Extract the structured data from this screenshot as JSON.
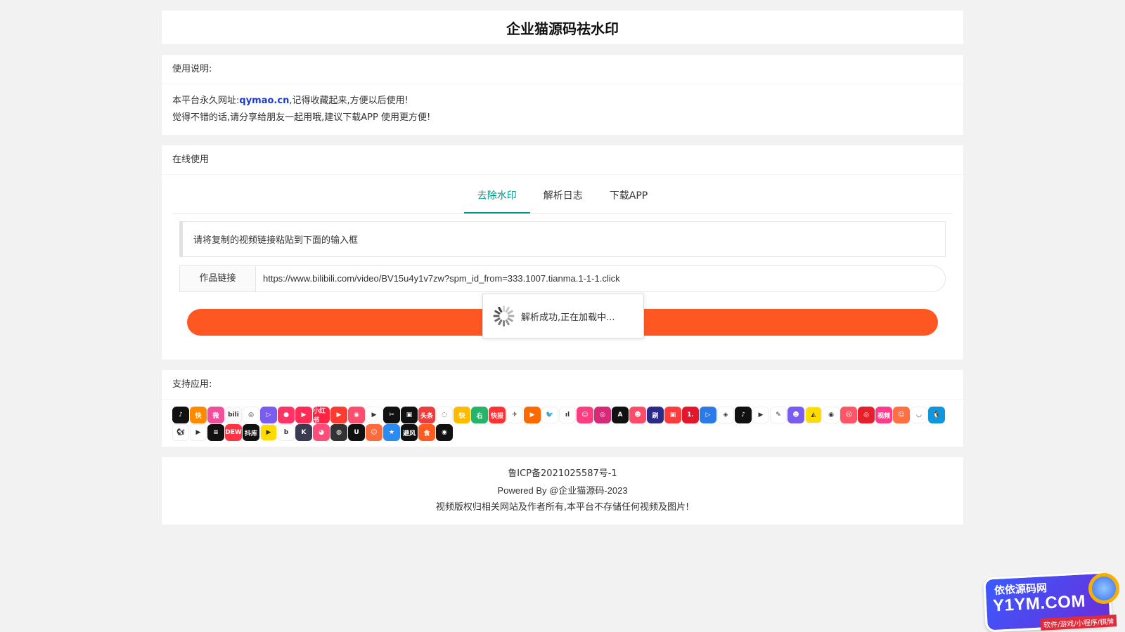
{
  "header": {
    "title": "企业猫源码祛水印"
  },
  "intro": {
    "heading": "使用说明:",
    "line1_prefix": "本平台永久网址:",
    "line1_link": "qymao.cn",
    "line1_suffix": ",记得收藏起来,方便以后使用!",
    "line2": "觉得不错的话,请分享给朋友一起用哦,建议下载APP 使用更方便!"
  },
  "online": {
    "heading": "在线使用",
    "tabs": [
      {
        "label": "去除水印",
        "active": true
      },
      {
        "label": "解析日志",
        "active": false
      },
      {
        "label": "下载APP",
        "active": false
      }
    ],
    "notice": "请将复制的视频链接粘贴到下面的输入框",
    "link_label": "作品链接",
    "link_value": "https://www.bilibili.com/video/BV15u4y1v7zw?spm_id_from=333.1007.tianma.1-1-1.click",
    "loading_text": "解析成功,正在加载中...",
    "button_color": "#ff5722"
  },
  "apps": {
    "heading": "支持应用:",
    "items": [
      {
        "icon": "douyin-icon",
        "color": "#111111",
        "glyph": "♪"
      },
      {
        "icon": "kuaishou-icon",
        "color": "#ff8a00",
        "glyph": "快"
      },
      {
        "icon": "weishi-icon",
        "color": "#f0509b",
        "glyph": "微"
      },
      {
        "icon": "bilibili-icon",
        "color": "#fafafa",
        "glyph": "bili"
      },
      {
        "icon": "weibo-icon",
        "color": "#ffffff",
        "glyph": "◎"
      },
      {
        "icon": "video-icon",
        "color": "#7b5cf0",
        "glyph": "▷"
      },
      {
        "icon": "pipi-icon",
        "color": "#ff3366",
        "glyph": "●"
      },
      {
        "icon": "haokan-icon",
        "color": "#ff2d55",
        "glyph": "▶"
      },
      {
        "icon": "xiaohongshu-icon",
        "color": "#ff2442",
        "glyph": "小红书"
      },
      {
        "icon": "huoshan-icon",
        "color": "#ff3b30",
        "glyph": "▶"
      },
      {
        "icon": "meipai-icon",
        "color": "#ff4d6d",
        "glyph": "◉"
      },
      {
        "icon": "player-icon",
        "color": "#ffffff",
        "glyph": "▶"
      },
      {
        "icon": "capcut-icon",
        "color": "#111111",
        "glyph": "✂"
      },
      {
        "icon": "xigua-icon",
        "color": "#111111",
        "glyph": "▣"
      },
      {
        "icon": "toutiao-icon",
        "color": "#ee3d3d",
        "glyph": "头条"
      },
      {
        "icon": "lvzhou-icon",
        "color": "#ffffff",
        "glyph": "◌"
      },
      {
        "icon": "kuaiyin-icon",
        "color": "#ffbb00",
        "glyph": "快"
      },
      {
        "icon": "zuiyou-icon",
        "color": "#26b36a",
        "glyph": "右"
      },
      {
        "icon": "kuaibao-icon",
        "color": "#ff3333",
        "glyph": "快报"
      },
      {
        "icon": "qq-kandian-icon",
        "color": "#ffffff",
        "glyph": "✈"
      },
      {
        "icon": "tudou-icon",
        "color": "#ff6a00",
        "glyph": "▶"
      },
      {
        "icon": "twitter-icon",
        "color": "#ffffff",
        "glyph": "🐦"
      },
      {
        "icon": "oasis-icon",
        "color": "#ffffff",
        "glyph": "ıl"
      },
      {
        "icon": "momo-icon",
        "color": "#ff3d80",
        "glyph": "☺"
      },
      {
        "icon": "instagram-icon",
        "color": "#d62976",
        "glyph": "◎"
      },
      {
        "icon": "acfun-icon",
        "color": "#111111",
        "glyph": "A"
      },
      {
        "icon": "kaiyan-icon",
        "color": "#ff4c6a",
        "glyph": "☻"
      },
      {
        "icon": "shuabao-icon",
        "color": "#2a2a88",
        "glyph": "刷"
      },
      {
        "icon": "quanmin-icon",
        "color": "#ff3b3b",
        "glyph": "▣"
      },
      {
        "icon": "yidian-icon",
        "color": "#e3172c",
        "glyph": "1."
      },
      {
        "icon": "youku-icon",
        "color": "#2c7ae6",
        "glyph": "▷"
      },
      {
        "icon": "iqiyi-icon",
        "color": "#ffffff",
        "glyph": "◈"
      },
      {
        "icon": "tiktok-icon",
        "color": "#111111",
        "glyph": "♪"
      },
      {
        "icon": "youtube-icon",
        "color": "#ffffff",
        "glyph": "▶"
      },
      {
        "icon": "weishi2-icon",
        "color": "#ffffff",
        "glyph": "✎"
      },
      {
        "icon": "qutoutiao-icon",
        "color": "#7b5cf0",
        "glyph": "☻"
      },
      {
        "icon": "piqu-icon",
        "color": "#ffdc00",
        "glyph": "◭"
      },
      {
        "icon": "eye-icon",
        "color": "#ffffff",
        "glyph": "◉"
      },
      {
        "icon": "face-icon",
        "color": "#ff5566",
        "glyph": "☹"
      },
      {
        "icon": "netease-icon",
        "color": "#e6202a",
        "glyph": "◎"
      },
      {
        "icon": "shipin-icon",
        "color": "#ff3c8c",
        "glyph": "视频"
      },
      {
        "icon": "mascot-icon",
        "color": "#ff7043",
        "glyph": "☺"
      },
      {
        "icon": "bowl-icon",
        "color": "#ffffff",
        "glyph": "◡"
      },
      {
        "icon": "qq-icon",
        "color": "#1296db",
        "glyph": "🐧"
      },
      {
        "icon": "uc-icon",
        "color": "#ffffff",
        "glyph": "🐿"
      },
      {
        "icon": "play-purple-icon",
        "color": "#ffffff",
        "glyph": "▶"
      },
      {
        "icon": "stripes-icon",
        "color": "#111111",
        "glyph": "≡"
      },
      {
        "icon": "dewu-icon",
        "color": "#ff3344",
        "glyph": "DEW"
      },
      {
        "icon": "douku-icon",
        "color": "#111111",
        "glyph": "抖库"
      },
      {
        "icon": "kuaishou-lite-icon",
        "color": "#ffdc00",
        "glyph": "▶"
      },
      {
        "icon": "b-icon",
        "color": "#ffffff",
        "glyph": "b"
      },
      {
        "icon": "k-icon",
        "color": "#3a3a50",
        "glyph": "K"
      },
      {
        "icon": "pop-icon",
        "color": "#ff4d7a",
        "glyph": "◕"
      },
      {
        "icon": "circle-icon",
        "color": "#333333",
        "glyph": "◍"
      },
      {
        "icon": "quxuan-icon",
        "color": "#111111",
        "glyph": "U"
      },
      {
        "icon": "monkey-icon",
        "color": "#ff6a3d",
        "glyph": "☺"
      },
      {
        "icon": "ribbon-icon",
        "color": "#2a8cf0",
        "glyph": "★"
      },
      {
        "icon": "bike-icon",
        "color": "#111111",
        "glyph": "避风"
      },
      {
        "icon": "food-icon",
        "color": "#ff5a1f",
        "glyph": "食"
      },
      {
        "icon": "ring-icon",
        "color": "#111111",
        "glyph": "◉"
      }
    ]
  },
  "footer": {
    "icp": "鲁ICP备2021025587号-1",
    "powered": "Powered By @企业猫源码-2023",
    "disclaimer": "视频版权归相关网站及作者所有,本平台不存储任何视频及图片!"
  },
  "watermark": {
    "line1": "依依源码网",
    "line2": "Y1YM.COM",
    "line3": "软件/游戏/小程序/棋牌"
  }
}
